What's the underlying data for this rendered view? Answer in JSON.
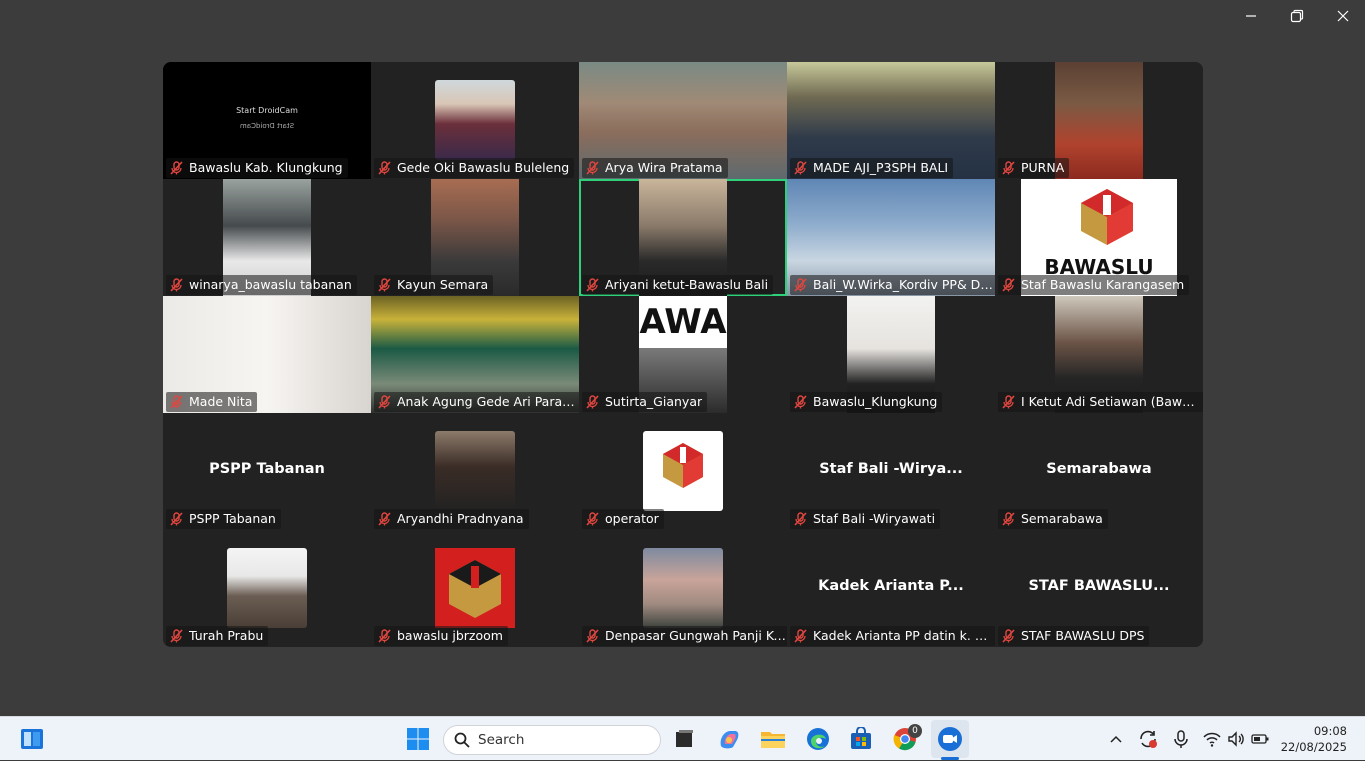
{
  "window": {
    "controls": [
      "minimize-icon",
      "restore-icon",
      "close-icon"
    ]
  },
  "gallery": {
    "active_speaker_color": "#2fd07a",
    "muted_color": "#e0463f",
    "participants": [
      {
        "name": "Bawaslu Kab. Klungkung",
        "video_text": "Start DroidCam"
      },
      {
        "name": "Gede Oki Bawaslu Buleleng"
      },
      {
        "name": "Arya Wira Pratama"
      },
      {
        "name": "MADE AJI_P3SPH BALI"
      },
      {
        "name": "PURNA"
      },
      {
        "name": "winarya_bawaslu tabanan"
      },
      {
        "name": "Kayun Semara"
      },
      {
        "name": "Ariyani ketut-Bawaslu Bali",
        "active": true
      },
      {
        "name": "Bali_W.Wirka_Kordiv PP& Datin"
      },
      {
        "name": "Staf Bawaslu Karangasem",
        "logo_text": "BAWASLU"
      },
      {
        "name": "Made Nita"
      },
      {
        "name": "Anak Agung Gede Ari Paramartha"
      },
      {
        "name": "Sutirta_Gianyar",
        "bg_text": "AWA"
      },
      {
        "name": "Bawaslu_Klungkung"
      },
      {
        "name": "I Ketut Adi Setiawan (Bawaslu Gianyar)"
      },
      {
        "name": "PSPP Tabanan",
        "display": "PSPP Tabanan"
      },
      {
        "name": "Aryandhi Pradnyana"
      },
      {
        "name": "operator"
      },
      {
        "name": "Staf Bali -Wiryawati",
        "display": "Staf Bali -Wirya..."
      },
      {
        "name": "Semarabawa",
        "display": "Semarabawa"
      },
      {
        "name": "Turah Prabu"
      },
      {
        "name": "bawaslu jbrzoom"
      },
      {
        "name": "Denpasar Gungwah Panji Kelana"
      },
      {
        "name": "Kadek Arianta PP datin k. Asem",
        "display": "Kadek Arianta P..."
      },
      {
        "name": "STAF BAWASLU DPS",
        "display": "STAF BAWASLU..."
      }
    ]
  },
  "taskbar": {
    "search_placeholder": "Search",
    "chrome_badge": "0",
    "time": "09:08",
    "date": "22/08/2025",
    "pinned": [
      "widgets-icon",
      "start-icon",
      "search-icon",
      "task-view-icon",
      "copilot-icon",
      "file-explorer-icon",
      "edge-icon",
      "store-icon",
      "chrome-icon",
      "zoom-icon"
    ],
    "tray": [
      "chevron-up-icon",
      "sync-icon",
      "mic-icon",
      "wifi-icon",
      "volume-icon",
      "battery-icon"
    ]
  }
}
